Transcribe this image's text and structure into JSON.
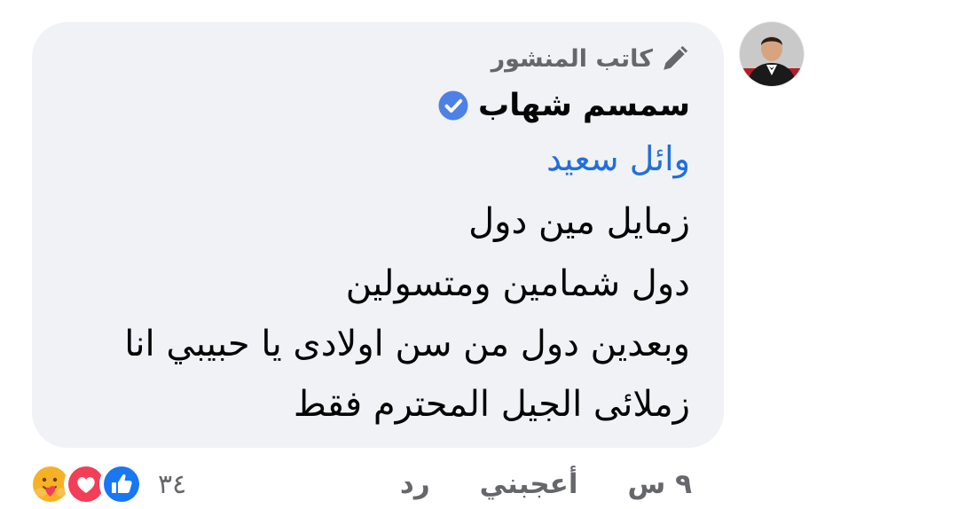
{
  "comment": {
    "author_badge": "كاتب المنشور",
    "author_name": "سمسم شهاب",
    "mention": "وائل سعيد",
    "lines": [
      "زمايل مين دول",
      "دول شمامين ومتسولين",
      "وبعدين دول من سن اولادى يا حبيبي انا",
      "زملائى الجيل المحترم فقط"
    ]
  },
  "actions": {
    "time": "٩ س",
    "like_label": "أعجبني",
    "reply_label": "رد"
  },
  "reactions": {
    "count": "٣٤",
    "types": [
      "like-icon",
      "love-icon",
      "care-icon"
    ]
  },
  "colors": {
    "bubble": "#f0f2f5",
    "mention": "#216fdb",
    "secondary_text": "#65676b",
    "verified": "#4d81e6",
    "like": "#1877f2",
    "love": "#f33e58",
    "care": "#f7b125"
  }
}
